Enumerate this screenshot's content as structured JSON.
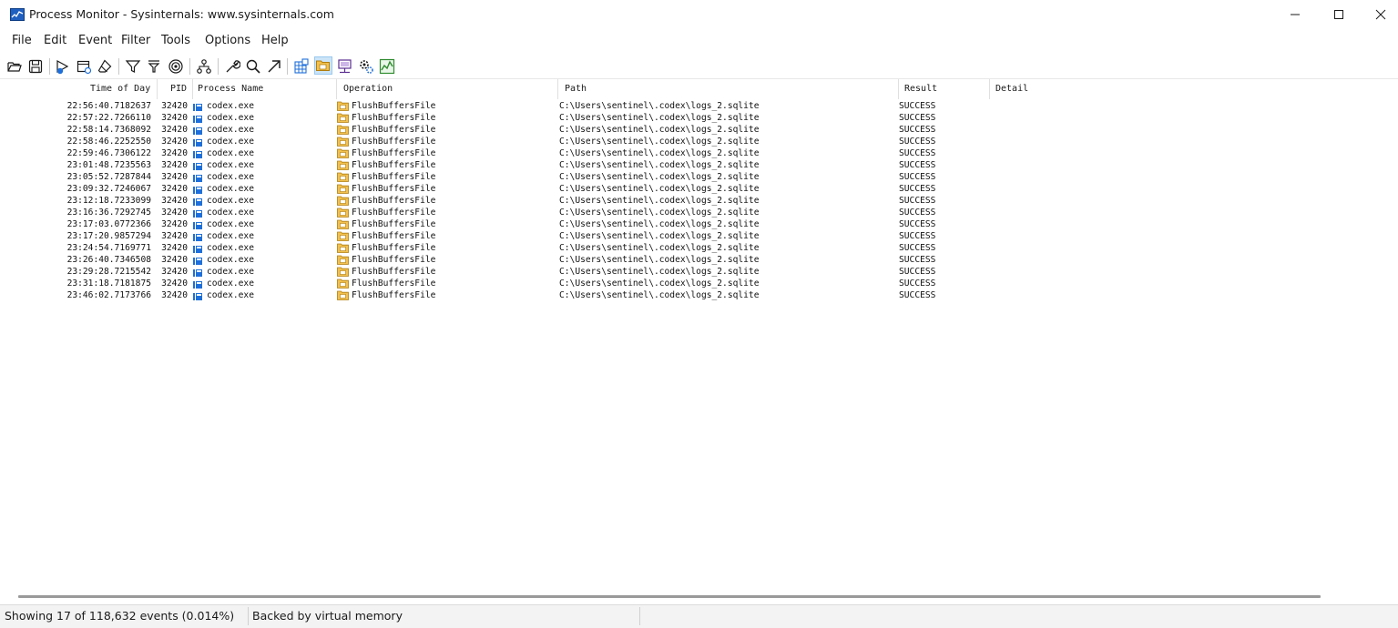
{
  "window": {
    "title": "Process Monitor - Sysinternals: www.sysinternals.com"
  },
  "menu": [
    "File",
    "Edit",
    "Event",
    "Filter",
    "Tools",
    "Options",
    "Help"
  ],
  "toolbar": {
    "icons": [
      "open-icon",
      "save-icon",
      "capture-icon",
      "autoscroll-icon",
      "clear-icon",
      "filter-icon",
      "highlight-icon",
      "include-process-icon",
      "process-tree-icon",
      "properties-icon",
      "find-icon",
      "jump-icon",
      "registry-activity-icon",
      "filesystem-activity-icon",
      "network-activity-icon",
      "process-activity-icon",
      "profiling-activity-icon"
    ],
    "active": "filesystem-activity-icon"
  },
  "columns": {
    "time": "Time of Day",
    "pid": "PID",
    "process": "Process Name",
    "operation": "Operation",
    "path": "Path",
    "result": "Result",
    "detail": "Detail"
  },
  "events": [
    {
      "time": "22:56:40.7182637",
      "pid": "32420",
      "process": "codex.exe",
      "operation": "FlushBuffersFile",
      "path": "C:\\Users\\sentinel\\.codex\\logs_2.sqlite",
      "result": "SUCCESS",
      "detail": ""
    },
    {
      "time": "22:57:22.7266110",
      "pid": "32420",
      "process": "codex.exe",
      "operation": "FlushBuffersFile",
      "path": "C:\\Users\\sentinel\\.codex\\logs_2.sqlite",
      "result": "SUCCESS",
      "detail": ""
    },
    {
      "time": "22:58:14.7368092",
      "pid": "32420",
      "process": "codex.exe",
      "operation": "FlushBuffersFile",
      "path": "C:\\Users\\sentinel\\.codex\\logs_2.sqlite",
      "result": "SUCCESS",
      "detail": ""
    },
    {
      "time": "22:58:46.2252550",
      "pid": "32420",
      "process": "codex.exe",
      "operation": "FlushBuffersFile",
      "path": "C:\\Users\\sentinel\\.codex\\logs_2.sqlite",
      "result": "SUCCESS",
      "detail": ""
    },
    {
      "time": "22:59:46.7306122",
      "pid": "32420",
      "process": "codex.exe",
      "operation": "FlushBuffersFile",
      "path": "C:\\Users\\sentinel\\.codex\\logs_2.sqlite",
      "result": "SUCCESS",
      "detail": ""
    },
    {
      "time": "23:01:48.7235563",
      "pid": "32420",
      "process": "codex.exe",
      "operation": "FlushBuffersFile",
      "path": "C:\\Users\\sentinel\\.codex\\logs_2.sqlite",
      "result": "SUCCESS",
      "detail": ""
    },
    {
      "time": "23:05:52.7287844",
      "pid": "32420",
      "process": "codex.exe",
      "operation": "FlushBuffersFile",
      "path": "C:\\Users\\sentinel\\.codex\\logs_2.sqlite",
      "result": "SUCCESS",
      "detail": ""
    },
    {
      "time": "23:09:32.7246067",
      "pid": "32420",
      "process": "codex.exe",
      "operation": "FlushBuffersFile",
      "path": "C:\\Users\\sentinel\\.codex\\logs_2.sqlite",
      "result": "SUCCESS",
      "detail": ""
    },
    {
      "time": "23:12:18.7233099",
      "pid": "32420",
      "process": "codex.exe",
      "operation": "FlushBuffersFile",
      "path": "C:\\Users\\sentinel\\.codex\\logs_2.sqlite",
      "result": "SUCCESS",
      "detail": ""
    },
    {
      "time": "23:16:36.7292745",
      "pid": "32420",
      "process": "codex.exe",
      "operation": "FlushBuffersFile",
      "path": "C:\\Users\\sentinel\\.codex\\logs_2.sqlite",
      "result": "SUCCESS",
      "detail": ""
    },
    {
      "time": "23:17:03.0772366",
      "pid": "32420",
      "process": "codex.exe",
      "operation": "FlushBuffersFile",
      "path": "C:\\Users\\sentinel\\.codex\\logs_2.sqlite",
      "result": "SUCCESS",
      "detail": ""
    },
    {
      "time": "23:17:20.9857294",
      "pid": "32420",
      "process": "codex.exe",
      "operation": "FlushBuffersFile",
      "path": "C:\\Users\\sentinel\\.codex\\logs_2.sqlite",
      "result": "SUCCESS",
      "detail": ""
    },
    {
      "time": "23:24:54.7169771",
      "pid": "32420",
      "process": "codex.exe",
      "operation": "FlushBuffersFile",
      "path": "C:\\Users\\sentinel\\.codex\\logs_2.sqlite",
      "result": "SUCCESS",
      "detail": ""
    },
    {
      "time": "23:26:40.7346508",
      "pid": "32420",
      "process": "codex.exe",
      "operation": "FlushBuffersFile",
      "path": "C:\\Users\\sentinel\\.codex\\logs_2.sqlite",
      "result": "SUCCESS",
      "detail": ""
    },
    {
      "time": "23:29:28.7215542",
      "pid": "32420",
      "process": "codex.exe",
      "operation": "FlushBuffersFile",
      "path": "C:\\Users\\sentinel\\.codex\\logs_2.sqlite",
      "result": "SUCCESS",
      "detail": ""
    },
    {
      "time": "23:31:18.7181875",
      "pid": "32420",
      "process": "codex.exe",
      "operation": "FlushBuffersFile",
      "path": "C:\\Users\\sentinel\\.codex\\logs_2.sqlite",
      "result": "SUCCESS",
      "detail": ""
    },
    {
      "time": "23:46:02.7173766",
      "pid": "32420",
      "process": "codex.exe",
      "operation": "FlushBuffersFile",
      "path": "C:\\Users\\sentinel\\.codex\\logs_2.sqlite",
      "result": "SUCCESS",
      "detail": ""
    }
  ],
  "status": {
    "showing": "Showing 17 of 118,632 events (0.014%)",
    "backing": "Backed by virtual memory"
  },
  "colors": {
    "active_toggle_bg": "#cce4f7",
    "folder_icon": "#e8a317",
    "process_icon": "#1e6fd9"
  }
}
